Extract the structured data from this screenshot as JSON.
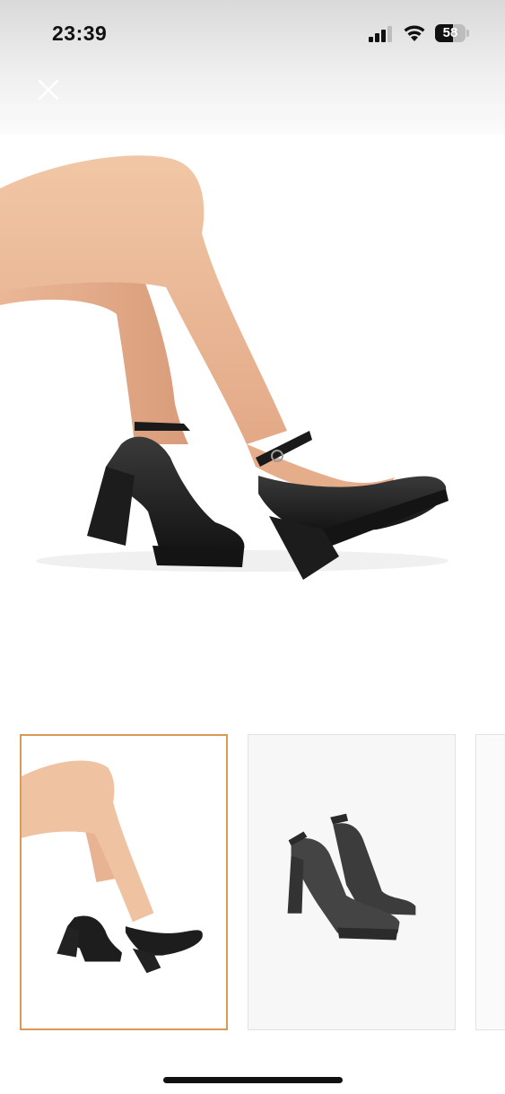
{
  "status_bar": {
    "time": "23:39",
    "battery_level": "58",
    "battery_fraction": 0.58
  },
  "viewer": {
    "close_icon": "close-icon",
    "main_image": "black-platform-mary-jane-heels-on-legs",
    "thumbnails": [
      {
        "image": "black-platform-mary-jane-heels-on-legs",
        "selected": true
      },
      {
        "image": "pair-of-black-platform-heels",
        "selected": false
      },
      {
        "image": "partial-third-thumbnail",
        "selected": false
      }
    ],
    "selected_border_color": "#d89a55"
  }
}
